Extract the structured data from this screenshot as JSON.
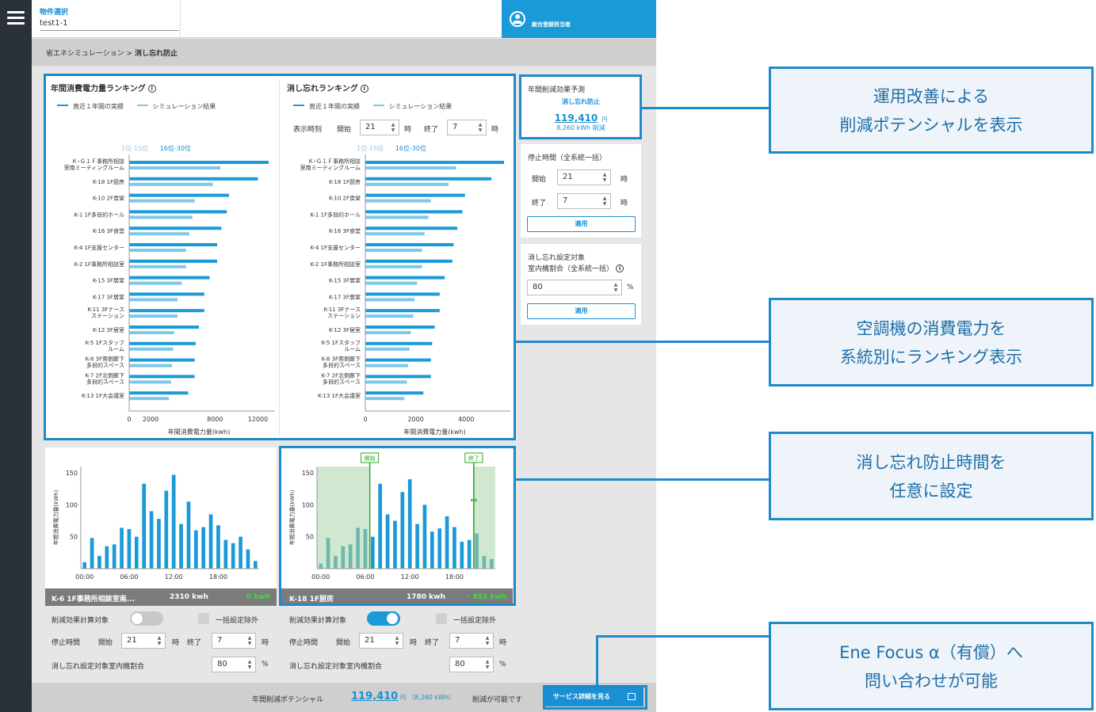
{
  "header": {
    "property_label": "物件選択",
    "property_value": "test1-1",
    "user_name": "総合登録担当者"
  },
  "breadcrumb": {
    "parent": "省エネシミュレーション",
    "sep": ">",
    "current": "消し忘れ防止"
  },
  "ranking_annual": {
    "title": "年間消費電力量ランキング",
    "legend_actual": "直近１年間の実績",
    "legend_sim": "シミュレーション結果",
    "page_a": "1位-15位",
    "page_b": "16位-30位",
    "xlabel": "年間消費電力量(kwh)"
  },
  "ranking_forget": {
    "title": "消し忘れランキング",
    "legend_actual": "直近１年間の実績",
    "legend_sim": "シミュレーション結果",
    "display_time_label": "表示時刻",
    "start_label": "開始",
    "start_value": "21",
    "end_label": "終了",
    "end_value": "7",
    "hour_unit": "時",
    "page_a": "1位-15位",
    "page_b": "16位-30位",
    "xlabel": "年間消費電力量(kwh)"
  },
  "forecast": {
    "title": "年間削減効果予測",
    "item": "消し忘れ防止",
    "amount": "119,410",
    "currency": "円",
    "kwh": "8,260 kWh 削減"
  },
  "stop_time": {
    "title": "停止時間（全系統一括）",
    "start_label": "開始",
    "start_value": "21",
    "end_label": "終了",
    "end_value": "7",
    "hour_unit": "時",
    "apply": "適用"
  },
  "ratio": {
    "title1": "消し忘れ設定対象",
    "title2": "室内機割合（全系統一括）",
    "value": "80",
    "unit": "%",
    "apply": "適用"
  },
  "units": {
    "left": {
      "footer_name": "K-6 1F事務所相談室南...",
      "footer_kwh": "2310 kwh",
      "footer_saving": "0 kwh",
      "calc_label": "削減効果計算対象",
      "exclude_label": "一括設定除外",
      "stop_label": "停止時間",
      "start_label": "開始",
      "start_value": "21",
      "end_label": "終了",
      "end_value": "7",
      "hour_unit": "時",
      "ratio_label": "消し忘れ設定対象室内機割合",
      "ratio_value": "80",
      "ratio_unit": "%"
    },
    "right": {
      "footer_name": "K-18 1F厨房",
      "footer_kwh": "1780 kwh",
      "footer_saving": "- 852 kwh",
      "calc_label": "削減効果計算対象",
      "exclude_label": "一括設定除外",
      "stop_label": "停止時間",
      "start_label": "開始",
      "start_value": "21",
      "end_label": "終了",
      "end_value": "7",
      "hour_unit": "時",
      "ratio_label": "消し忘れ設定対象室内機割合",
      "ratio_value": "80",
      "ratio_unit": "%",
      "marker_start": "開始",
      "marker_end": "終了"
    }
  },
  "bottom": {
    "label": "年間削減ポテンシャル",
    "amount": "119,410",
    "currency": "円",
    "kwh": "（8,260 kWh）",
    "suffix": "削減が可能です",
    "service_button": "サービス詳細を見る"
  },
  "callouts": {
    "c1_line1": "運用改善による",
    "c1_line2": "削減ポテンシャルを表示",
    "c2_line1": "空調機の消費電力を",
    "c2_line2": "系統別にランキング表示",
    "c3_line1": "消し忘れ防止時間を",
    "c3_line2": "任意に設定",
    "c4_line1": "Ene Focus α（有償）へ",
    "c4_line2": "問い合わせが可能"
  },
  "colors": {
    "actual": "#1a9ad6",
    "sim": "#7dc8ea",
    "accent": "#1e8ac9",
    "saving_green": "#2aa52a",
    "off_band": "#cfe8cf"
  },
  "chart_data": [
    {
      "type": "bar",
      "title": "年間消費電力量ランキング",
      "xlabel": "年間消費電力量(kwh)",
      "xlim": [
        0,
        13000
      ],
      "xticks": [
        0,
        2000,
        8000,
        12000
      ],
      "categories": [
        "ＫｰＧ１Ｆ事務所相談室南ミーティングルーム",
        "K-18 1F厨房",
        "K-10 2F食堂",
        "K-1 1F多目的ホール",
        "K-16 3F食堂",
        "K-4 1F支援センター",
        "K-2 1F事務所相談室",
        "K-15 3F居室",
        "K-17 3F居室",
        "K-11 3Fナースステーション",
        "K-12 3F居室",
        "K-5 1Fスタッフルーム",
        "K-8 3F南側廊下多目的スペース",
        "K-7 2F北側廊下多目的スペース",
        "K-13 1F大会議室"
      ],
      "series": [
        {
          "name": "直近１年間の実績",
          "values": [
            13000,
            12000,
            9300,
            9100,
            8600,
            8200,
            8200,
            7500,
            7000,
            7000,
            6500,
            6200,
            6100,
            6100,
            5500
          ]
        },
        {
          "name": "シミュレーション結果",
          "values": [
            8500,
            7800,
            6100,
            5900,
            5600,
            5300,
            5300,
            4900,
            4500,
            4500,
            4200,
            4100,
            4000,
            3900,
            3700
          ]
        }
      ]
    },
    {
      "type": "bar",
      "title": "消し忘れランキング",
      "xlabel": "年間消費電力量(kwh)",
      "xlim": [
        0,
        5500
      ],
      "xticks": [
        0,
        2000,
        4000
      ],
      "categories": [
        "ＫｰＧ１Ｆ事務所相談室南ミーティングルーム",
        "K-18 1F厨房",
        "K-10 2F食堂",
        "K-1 1F多目的ホール",
        "K-16 3F食堂",
        "K-4 1F支援センター",
        "K-2 1F事務所相談室",
        "K-15 3F居室",
        "K-17 3F居室",
        "K-11 3Fナースステーション",
        "K-12 3F居室",
        "K-5 1Fスタッフルーム",
        "K-8 3F南側廊下多目的スペース",
        "K-7 2F北側廊下多目的スペース",
        "K-13 1F大会議室"
      ],
      "series": [
        {
          "name": "直近１年間の実績",
          "values": [
            5500,
            5000,
            3950,
            3850,
            3650,
            3500,
            3450,
            3150,
            2950,
            2950,
            2750,
            2650,
            2600,
            2600,
            2300
          ]
        },
        {
          "name": "シミュレーション結果",
          "values": [
            3600,
            3300,
            2600,
            2500,
            2350,
            2250,
            2250,
            2050,
            1950,
            1900,
            1800,
            1750,
            1700,
            1650,
            1550
          ]
        }
      ]
    },
    {
      "type": "bar",
      "title": "K-6 1F事務所相談室南...",
      "ylabel": "年間消費電力量(kWh)",
      "ylim": [
        0,
        160
      ],
      "yticks": [
        50,
        100,
        150
      ],
      "xticks": [
        "00:00",
        "06:00",
        "12:00",
        "18:00"
      ],
      "values": [
        10,
        48,
        20,
        35,
        38,
        64,
        62,
        50,
        133,
        90,
        78,
        122,
        147,
        70,
        105,
        60,
        65,
        85,
        68,
        45,
        40,
        50,
        30,
        12
      ]
    },
    {
      "type": "bar",
      "title": "K-18 1F厨房",
      "ylabel": "年間消費電力量(kWh)",
      "ylim": [
        0,
        160
      ],
      "yticks": [
        50,
        100,
        150
      ],
      "xticks": [
        "00:00",
        "06:00",
        "12:00",
        "18:00"
      ],
      "off_start": "21:00",
      "off_end": "07:00",
      "values": [
        8,
        48,
        20,
        35,
        38,
        64,
        62,
        50,
        133,
        85,
        75,
        120,
        140,
        70,
        100,
        58,
        63,
        82,
        65,
        42,
        45,
        55,
        20,
        15
      ]
    }
  ]
}
